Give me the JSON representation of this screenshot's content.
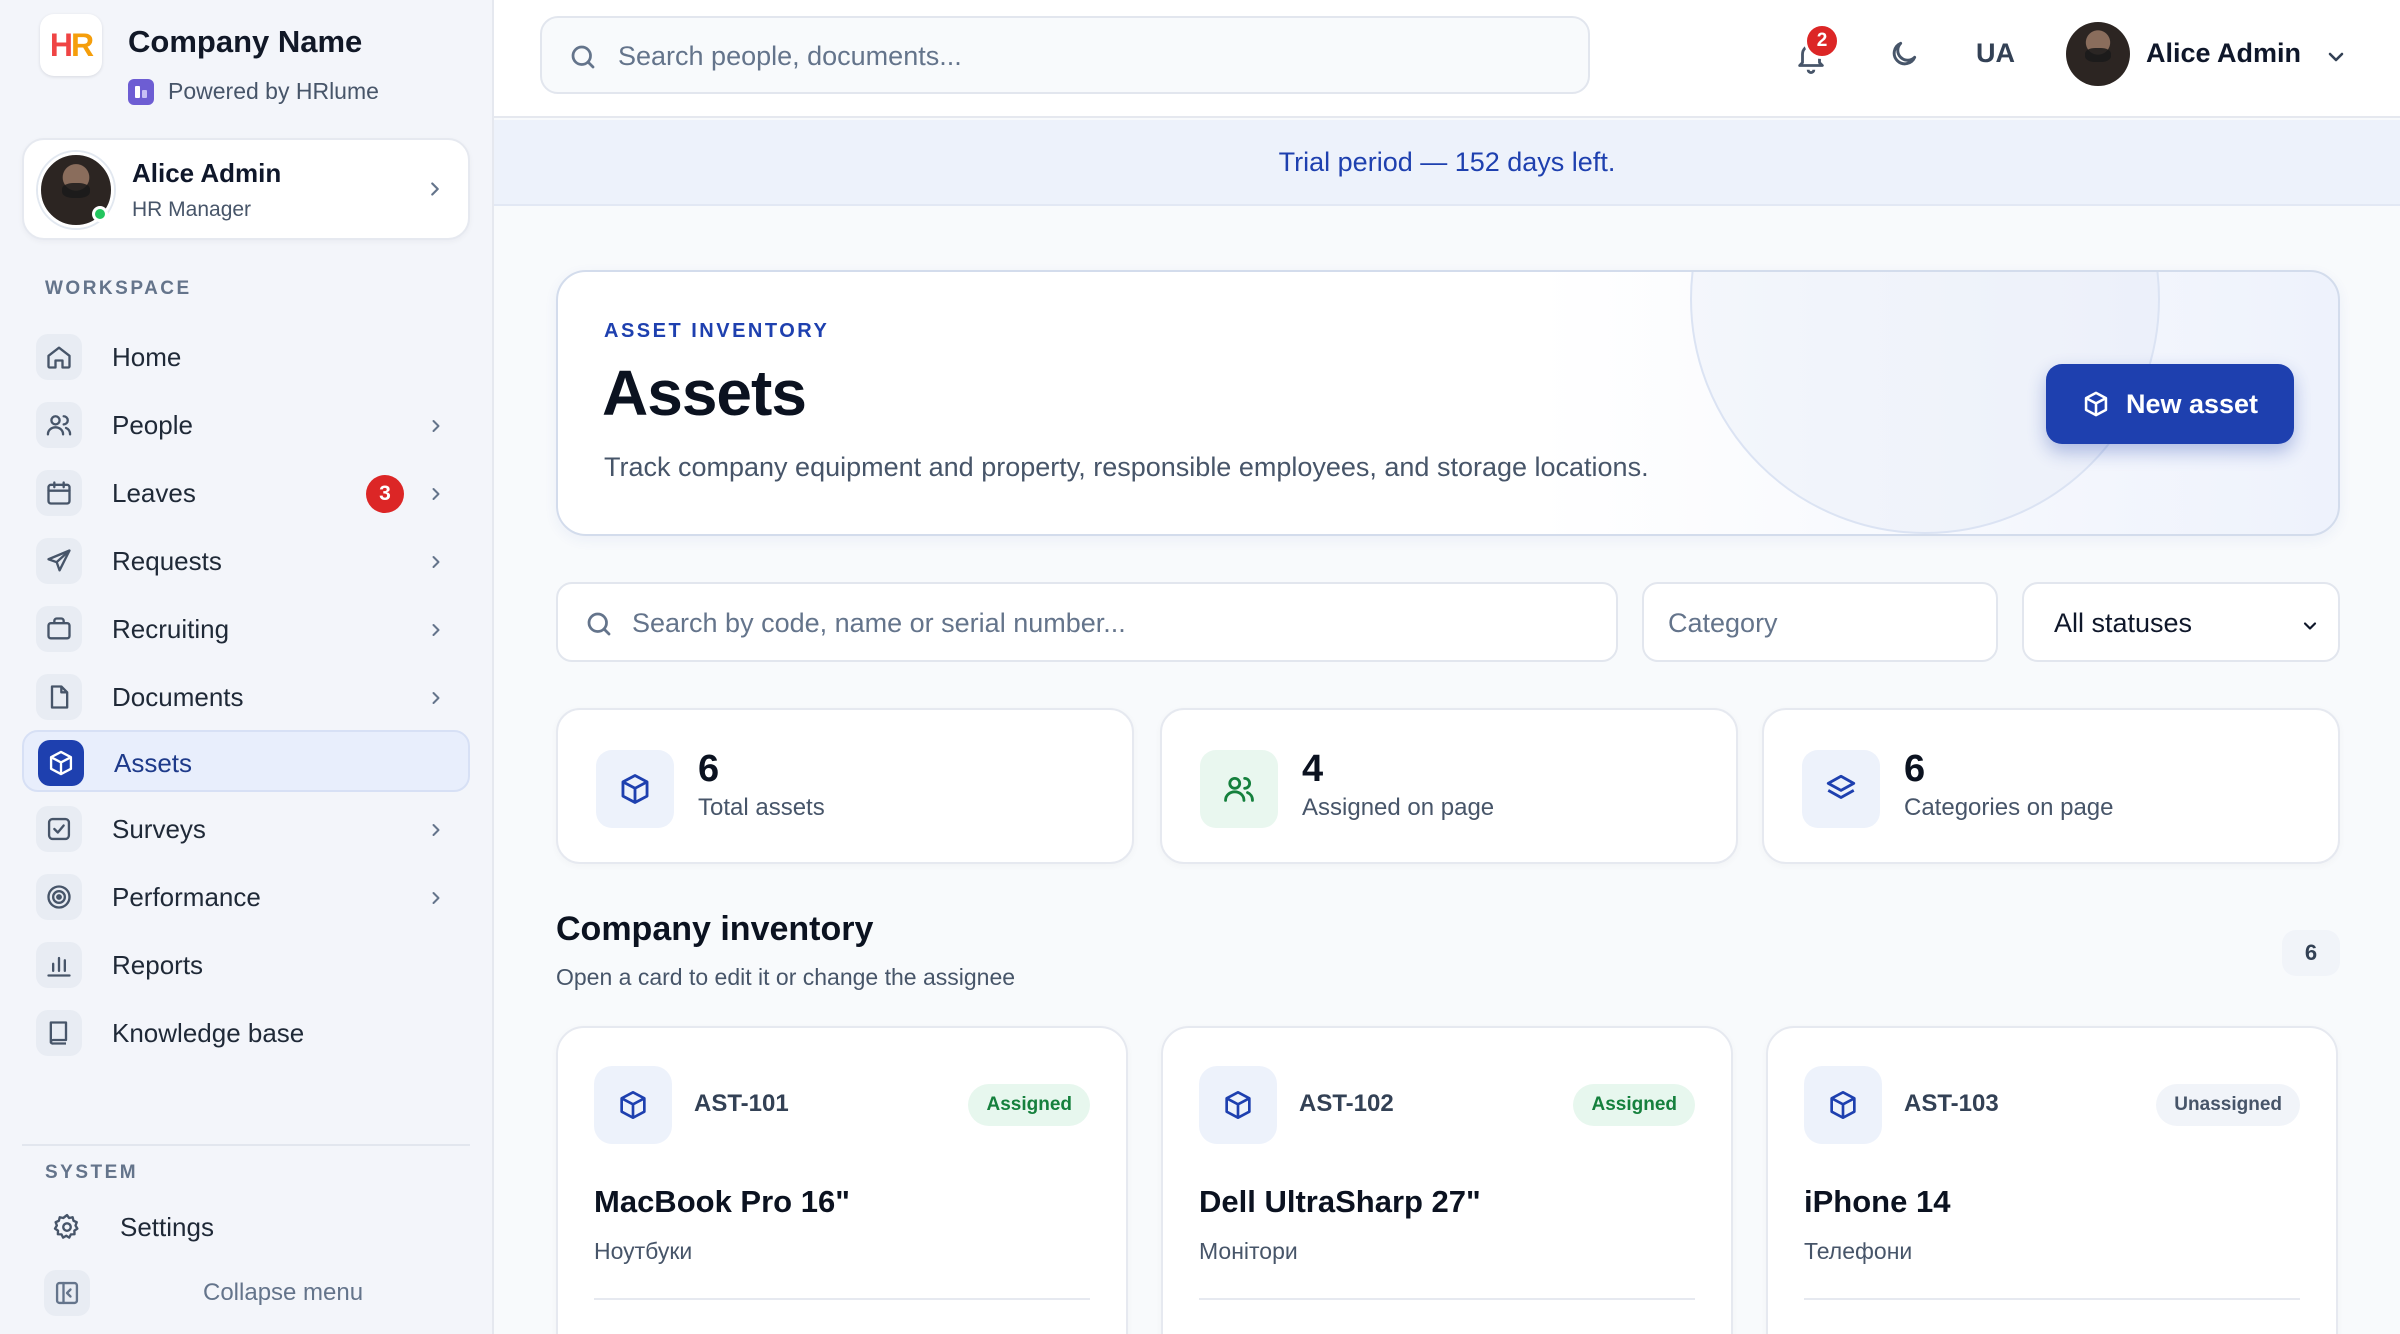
{
  "brand": {
    "logo_text_h": "H",
    "logo_text_r": "R",
    "company_name": "Company Name",
    "powered_by": "Powered by HRlume"
  },
  "sidebar": {
    "user": {
      "name": "Alice Admin",
      "role": "HR Manager",
      "status": "online"
    },
    "workspace_label": "WORKSPACE",
    "items": [
      {
        "label": "Home",
        "icon": "home-icon",
        "has_chevron": false
      },
      {
        "label": "People",
        "icon": "people-icon",
        "has_chevron": true
      },
      {
        "label": "Leaves",
        "icon": "calendar-icon",
        "has_chevron": true,
        "badge": "3"
      },
      {
        "label": "Requests",
        "icon": "send-icon",
        "has_chevron": true
      },
      {
        "label": "Recruiting",
        "icon": "briefcase-icon",
        "has_chevron": true
      },
      {
        "label": "Documents",
        "icon": "document-icon",
        "has_chevron": true
      },
      {
        "label": "Assets",
        "icon": "box-icon",
        "has_chevron": false,
        "active": true
      },
      {
        "label": "Surveys",
        "icon": "checkbox-icon",
        "has_chevron": true
      },
      {
        "label": "Performance",
        "icon": "target-icon",
        "has_chevron": true
      },
      {
        "label": "Reports",
        "icon": "bar-chart-icon",
        "has_chevron": false
      },
      {
        "label": "Knowledge base",
        "icon": "book-icon",
        "has_chevron": false
      }
    ],
    "system_label": "SYSTEM",
    "settings_label": "Settings",
    "collapse_label": "Collapse menu"
  },
  "topbar": {
    "search_placeholder": "Search people, documents...",
    "notification_count": "2",
    "language": "UA",
    "user_name": "Alice Admin"
  },
  "trial_banner": "Trial period — 152 days left.",
  "hero": {
    "eyebrow": "ASSET INVENTORY",
    "title": "Assets",
    "subtitle": "Track company equipment and property, responsible employees, and storage locations.",
    "new_button": "New asset"
  },
  "filters": {
    "search_placeholder": "Search by code, name or serial number...",
    "category_placeholder": "Category",
    "status_value": "All statuses"
  },
  "stats": [
    {
      "value": "6",
      "label": "Total assets",
      "icon": "box-icon"
    },
    {
      "value": "4",
      "label": "Assigned on page",
      "icon": "people-icon"
    },
    {
      "value": "6",
      "label": "Categories on page",
      "icon": "layers-icon"
    }
  ],
  "inventory": {
    "title": "Company inventory",
    "subtitle": "Open a card to edit it or change the assignee",
    "count": "6",
    "cards": [
      {
        "code": "AST-101",
        "status": "Assigned",
        "name": "MacBook Pro 16\"",
        "category": "Ноутбуки"
      },
      {
        "code": "AST-102",
        "status": "Assigned",
        "name": "Dell UltraSharp 27\"",
        "category": "Монітори"
      },
      {
        "code": "AST-103",
        "status": "Unassigned",
        "name": "iPhone 14",
        "category": "Телефони"
      }
    ]
  },
  "colors": {
    "accent": "#1e40af",
    "danger_badge": "#dc2626",
    "online": "#22c55e",
    "assigned_text": "#15803d",
    "assigned_bg": "#e7f7ee"
  }
}
